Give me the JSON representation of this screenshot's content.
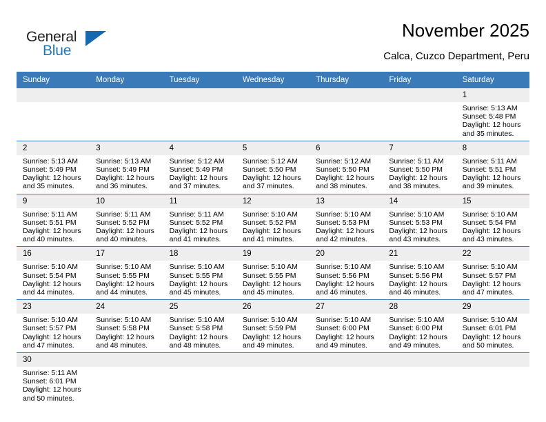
{
  "brand": {
    "line1": "General",
    "line2": "Blue",
    "triangle_icon": "triangle-icon",
    "color_dark": "#231f20",
    "color_blue": "#1d76bb"
  },
  "header": {
    "title": "November 2025",
    "subtitle": "Calca, Cuzco Department, Peru"
  },
  "theme": {
    "header_row_bg": "#3a7ab8",
    "header_row_text": "#ffffff",
    "daynum_bg": "#eeeeee",
    "cell_bg": "#ffffff",
    "row_border": "#3a7ab8"
  },
  "weekday_headers": [
    "Sunday",
    "Monday",
    "Tuesday",
    "Wednesday",
    "Thursday",
    "Friday",
    "Saturday"
  ],
  "weeks": [
    [
      {
        "day": "",
        "lines": []
      },
      {
        "day": "",
        "lines": []
      },
      {
        "day": "",
        "lines": []
      },
      {
        "day": "",
        "lines": []
      },
      {
        "day": "",
        "lines": []
      },
      {
        "day": "",
        "lines": []
      },
      {
        "day": "1",
        "lines": [
          "Sunrise: 5:13 AM",
          "Sunset: 5:48 PM",
          "Daylight: 12 hours and 35 minutes."
        ]
      }
    ],
    [
      {
        "day": "2",
        "lines": [
          "Sunrise: 5:13 AM",
          "Sunset: 5:49 PM",
          "Daylight: 12 hours and 35 minutes."
        ]
      },
      {
        "day": "3",
        "lines": [
          "Sunrise: 5:13 AM",
          "Sunset: 5:49 PM",
          "Daylight: 12 hours and 36 minutes."
        ]
      },
      {
        "day": "4",
        "lines": [
          "Sunrise: 5:12 AM",
          "Sunset: 5:49 PM",
          "Daylight: 12 hours and 37 minutes."
        ]
      },
      {
        "day": "5",
        "lines": [
          "Sunrise: 5:12 AM",
          "Sunset: 5:50 PM",
          "Daylight: 12 hours and 37 minutes."
        ]
      },
      {
        "day": "6",
        "lines": [
          "Sunrise: 5:12 AM",
          "Sunset: 5:50 PM",
          "Daylight: 12 hours and 38 minutes."
        ]
      },
      {
        "day": "7",
        "lines": [
          "Sunrise: 5:11 AM",
          "Sunset: 5:50 PM",
          "Daylight: 12 hours and 38 minutes."
        ]
      },
      {
        "day": "8",
        "lines": [
          "Sunrise: 5:11 AM",
          "Sunset: 5:51 PM",
          "Daylight: 12 hours and 39 minutes."
        ]
      }
    ],
    [
      {
        "day": "9",
        "lines": [
          "Sunrise: 5:11 AM",
          "Sunset: 5:51 PM",
          "Daylight: 12 hours and 40 minutes."
        ]
      },
      {
        "day": "10",
        "lines": [
          "Sunrise: 5:11 AM",
          "Sunset: 5:52 PM",
          "Daylight: 12 hours and 40 minutes."
        ]
      },
      {
        "day": "11",
        "lines": [
          "Sunrise: 5:11 AM",
          "Sunset: 5:52 PM",
          "Daylight: 12 hours and 41 minutes."
        ]
      },
      {
        "day": "12",
        "lines": [
          "Sunrise: 5:10 AM",
          "Sunset: 5:52 PM",
          "Daylight: 12 hours and 41 minutes."
        ]
      },
      {
        "day": "13",
        "lines": [
          "Sunrise: 5:10 AM",
          "Sunset: 5:53 PM",
          "Daylight: 12 hours and 42 minutes."
        ]
      },
      {
        "day": "14",
        "lines": [
          "Sunrise: 5:10 AM",
          "Sunset: 5:53 PM",
          "Daylight: 12 hours and 43 minutes."
        ]
      },
      {
        "day": "15",
        "lines": [
          "Sunrise: 5:10 AM",
          "Sunset: 5:54 PM",
          "Daylight: 12 hours and 43 minutes."
        ]
      }
    ],
    [
      {
        "day": "16",
        "lines": [
          "Sunrise: 5:10 AM",
          "Sunset: 5:54 PM",
          "Daylight: 12 hours and 44 minutes."
        ]
      },
      {
        "day": "17",
        "lines": [
          "Sunrise: 5:10 AM",
          "Sunset: 5:55 PM",
          "Daylight: 12 hours and 44 minutes."
        ]
      },
      {
        "day": "18",
        "lines": [
          "Sunrise: 5:10 AM",
          "Sunset: 5:55 PM",
          "Daylight: 12 hours and 45 minutes."
        ]
      },
      {
        "day": "19",
        "lines": [
          "Sunrise: 5:10 AM",
          "Sunset: 5:55 PM",
          "Daylight: 12 hours and 45 minutes."
        ]
      },
      {
        "day": "20",
        "lines": [
          "Sunrise: 5:10 AM",
          "Sunset: 5:56 PM",
          "Daylight: 12 hours and 46 minutes."
        ]
      },
      {
        "day": "21",
        "lines": [
          "Sunrise: 5:10 AM",
          "Sunset: 5:56 PM",
          "Daylight: 12 hours and 46 minutes."
        ]
      },
      {
        "day": "22",
        "lines": [
          "Sunrise: 5:10 AM",
          "Sunset: 5:57 PM",
          "Daylight: 12 hours and 47 minutes."
        ]
      }
    ],
    [
      {
        "day": "23",
        "lines": [
          "Sunrise: 5:10 AM",
          "Sunset: 5:57 PM",
          "Daylight: 12 hours and 47 minutes."
        ]
      },
      {
        "day": "24",
        "lines": [
          "Sunrise: 5:10 AM",
          "Sunset: 5:58 PM",
          "Daylight: 12 hours and 48 minutes."
        ]
      },
      {
        "day": "25",
        "lines": [
          "Sunrise: 5:10 AM",
          "Sunset: 5:58 PM",
          "Daylight: 12 hours and 48 minutes."
        ]
      },
      {
        "day": "26",
        "lines": [
          "Sunrise: 5:10 AM",
          "Sunset: 5:59 PM",
          "Daylight: 12 hours and 49 minutes."
        ]
      },
      {
        "day": "27",
        "lines": [
          "Sunrise: 5:10 AM",
          "Sunset: 6:00 PM",
          "Daylight: 12 hours and 49 minutes."
        ]
      },
      {
        "day": "28",
        "lines": [
          "Sunrise: 5:10 AM",
          "Sunset: 6:00 PM",
          "Daylight: 12 hours and 49 minutes."
        ]
      },
      {
        "day": "29",
        "lines": [
          "Sunrise: 5:10 AM",
          "Sunset: 6:01 PM",
          "Daylight: 12 hours and 50 minutes."
        ]
      }
    ],
    [
      {
        "day": "30",
        "lines": [
          "Sunrise: 5:11 AM",
          "Sunset: 6:01 PM",
          "Daylight: 12 hours and 50 minutes."
        ]
      },
      {
        "day": "",
        "lines": []
      },
      {
        "day": "",
        "lines": []
      },
      {
        "day": "",
        "lines": []
      },
      {
        "day": "",
        "lines": []
      },
      {
        "day": "",
        "lines": []
      },
      {
        "day": "",
        "lines": []
      }
    ]
  ]
}
